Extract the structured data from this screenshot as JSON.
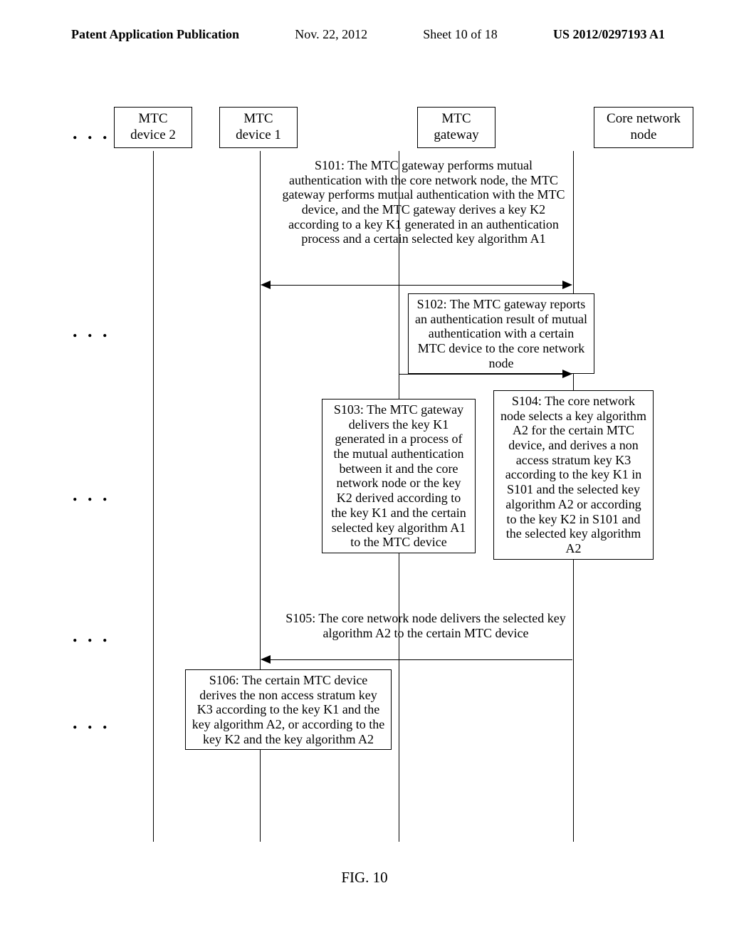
{
  "header": {
    "title": "Patent Application Publication",
    "date": "Nov. 22, 2012",
    "sheet": "Sheet 10 of 18",
    "docnum": "US 2012/0297193 A1"
  },
  "entities": {
    "dev2": "MTC\ndevice 2",
    "dev1": "MTC\ndevice 1",
    "gw": "MTC\ngateway",
    "core": "Core network\nnode"
  },
  "steps": {
    "s101": "S101: The MTC gateway performs mutual authentication with the core network node, the MTC gateway performs mutual authentication with the MTC device, and the MTC gateway derives a key K2 according to a key K1 generated in an authentication process and a certain selected key algorithm A1",
    "s102": "S102: The MTC gateway reports an authentication result of mutual authentication with a certain MTC device to the core network node",
    "s103": "S103: The MTC gateway delivers the key K1 generated in a process of the mutual authentication between it and the core network node or the key K2 derived according to the key K1 and the certain selected key algorithm A1 to the MTC device",
    "s104": "S104: The core network node selects a key algorithm A2 for the certain MTC device, and derives a non access stratum key K3 according to the key K1 in S101 and the selected key algorithm A2 or according to the key K2 in S101 and the selected key algorithm A2",
    "s105": "S105: The core network node delivers the selected key algorithm A2 to the certain MTC device",
    "s106": "S106: The certain MTC device derives the non access stratum key K3 according to the key K1 and the key algorithm A2, or according to the key K2 and the key algorithm A2"
  },
  "figure_label": "FIG. 10",
  "ellipsis": ". . ."
}
